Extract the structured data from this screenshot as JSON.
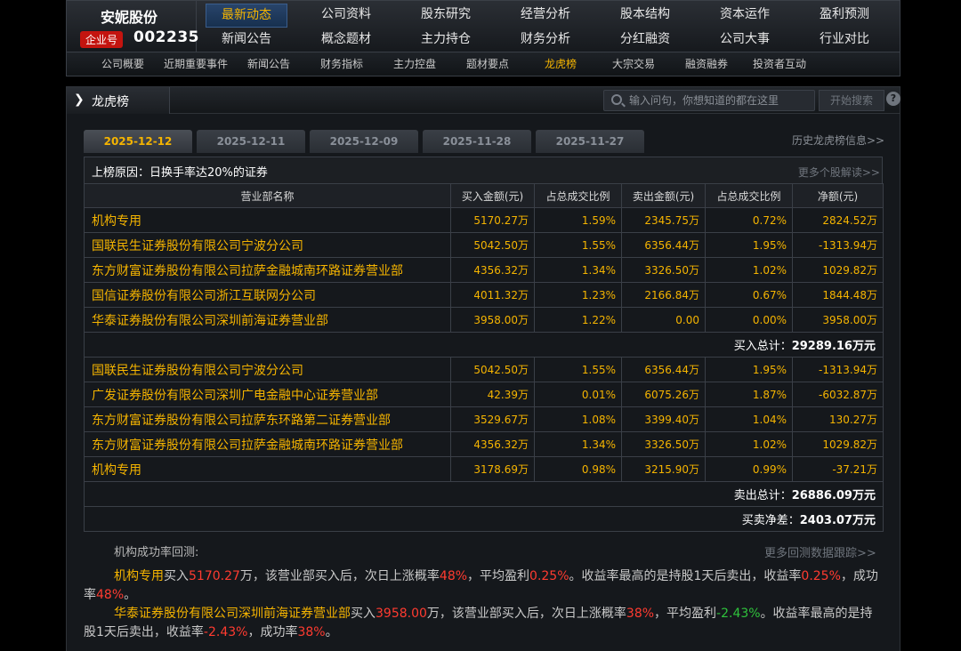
{
  "company": {
    "name": "安妮股份",
    "badge": "企业号",
    "code": "002235"
  },
  "nav_row1": [
    "最新动态",
    "公司资料",
    "股东研究",
    "经营分析",
    "股本结构",
    "资本运作",
    "盈利预测"
  ],
  "nav_row2": [
    "新闻公告",
    "概念题材",
    "主力持仓",
    "财务分析",
    "分红融资",
    "公司大事",
    "行业对比"
  ],
  "subnav": [
    "公司概要",
    "近期重要事件",
    "新闻公告",
    "财务指标",
    "主力控盘",
    "题材要点",
    "龙虎榜",
    "大宗交易",
    "融资融券",
    "投资者互动"
  ],
  "panel": {
    "title": "龙虎榜",
    "search_placeholder": "输入问句，你想知道的都在这里",
    "search_button": "开始搜索",
    "help": "?"
  },
  "date_tabs": [
    "2025-12-12",
    "2025-12-11",
    "2025-12-09",
    "2025-11-28",
    "2025-11-27"
  ],
  "history_link": "历史龙虎榜信息>>",
  "reason": {
    "label": "上榜原因：",
    "text": "日换手率达20%的证券",
    "more": "更多个股解读>>"
  },
  "columns": [
    "营业部名称",
    "买入金额(元)",
    "占总成交比例",
    "卖出金额(元)",
    "占总成交比例",
    "净额(元)"
  ],
  "buy_rows": [
    [
      "机构专用",
      "5170.27万",
      "1.59%",
      "2345.75万",
      "0.72%",
      "2824.52万"
    ],
    [
      "国联民生证券股份有限公司宁波分公司",
      "5042.50万",
      "1.55%",
      "6356.44万",
      "1.95%",
      "-1313.94万"
    ],
    [
      "东方财富证券股份有限公司拉萨金融城南环路证券营业部",
      "4356.32万",
      "1.34%",
      "3326.50万",
      "1.02%",
      "1029.82万"
    ],
    [
      "国信证券股份有限公司浙江互联网分公司",
      "4011.32万",
      "1.23%",
      "2166.84万",
      "0.67%",
      "1844.48万"
    ],
    [
      "华泰证券股份有限公司深圳前海证券营业部",
      "3958.00万",
      "1.22%",
      "0.00",
      "0.00%",
      "3958.00万"
    ]
  ],
  "buy_total": {
    "label": "买入总计：",
    "value": "29289.16",
    "unit": "万元"
  },
  "sell_rows": [
    [
      "国联民生证券股份有限公司宁波分公司",
      "5042.50万",
      "1.55%",
      "6356.44万",
      "1.95%",
      "-1313.94万"
    ],
    [
      "广发证券股份有限公司深圳广电金融中心证券营业部",
      "42.39万",
      "0.01%",
      "6075.26万",
      "1.87%",
      "-6032.87万"
    ],
    [
      "东方财富证券股份有限公司拉萨东环路第二证券营业部",
      "3529.67万",
      "1.08%",
      "3399.40万",
      "1.04%",
      "130.27万"
    ],
    [
      "东方财富证券股份有限公司拉萨金融城南环路证券营业部",
      "4356.32万",
      "1.34%",
      "3326.50万",
      "1.02%",
      "1029.82万"
    ],
    [
      "机构专用",
      "3178.69万",
      "0.98%",
      "3215.90万",
      "0.99%",
      "-37.21万"
    ]
  ],
  "sell_total": {
    "label": "卖出总计：",
    "value": "26886.09",
    "unit": "万元"
  },
  "net_total": {
    "label": "买卖净差：",
    "value": "2403.07",
    "unit": "万元"
  },
  "backtest": {
    "title": "机构成功率回测:",
    "more": "更多回测数据跟踪>>",
    "p1": {
      "seat": "机构专用",
      "t1": "买入",
      "buy": "5170.27",
      "t2": "万，该营业部买入后，次日上涨概率",
      "prob": "48%",
      "t3": "，平均盈利",
      "avg": "0.25%",
      "t4": "。收益率最高的是持股1天后卖出，收益率",
      "ret": "0.25%",
      "t5": "，成功率",
      "succ": "48%",
      "t6": "。"
    },
    "p2": {
      "seat": "华泰证券股份有限公司深圳前海证券营业部",
      "t1": "买入",
      "buy": "3958.00",
      "t2": "万，该营业部买入后，次日上涨概率",
      "prob": "38%",
      "t3": "，平均盈利",
      "avg": "-2.43%",
      "t4": "。收益率最高的是持股1天后卖出，收益率",
      "ret": "-2.43%",
      "t5": "，成功率",
      "succ": "38%",
      "t6": "。"
    }
  }
}
